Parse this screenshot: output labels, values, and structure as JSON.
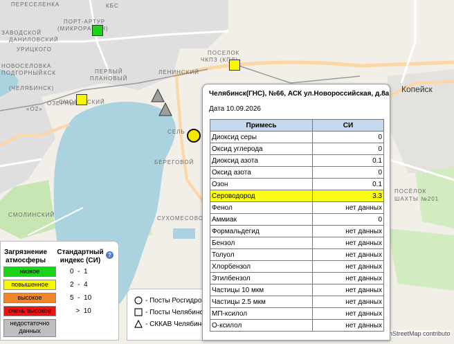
{
  "map": {
    "labels": {
      "pereselenka": "ПЕРЕСЕЛЕНКА",
      "kbs": "КБС",
      "port_artur": "ПОРТ-АРТУР",
      "mikrorayon": "(МИКРОРАЙОН)",
      "zavodskoy": "ЗАВОДСКОЙ",
      "danilovskiy": "ДАНИЛОВСКИЙ",
      "urickogo": "УРИЦКОГО",
      "poselok1": "ПОСЕЛОК",
      "chkpz": "ЧКПЗ (КПД)",
      "leninskiy": "ЛЕНИНСКИЙ",
      "pervyy": "ПЕРВЫЙ",
      "planovyy": "ПЛАНОВЫЙ",
      "novoselovka": "НОВОСЕЛОВКА",
      "podgornyy": "ПОДГОРНЫЙ",
      "ksk": "КСК",
      "chelyabinsk_paren": "(ЧЕЛЯБИНСК)",
      "smolenskiy": "СМОЛЕНСКИЙ",
      "o2": "«О2»",
      "ozernyy": "ОЗЕРНЫЙ",
      "sel": "СЕЛЬ",
      "beregovoy": "БЕРЕГОВОЙ",
      "smolinskiy": "СМОЛИНСКИЙ",
      "suhomesovo": "СУХОМЕСОВО",
      "kopeysk": "Копейск",
      "poselok2": "ПОСЁЛОК",
      "shahty": "ШАХТЫ №201"
    },
    "attribution": "enStreetMap contributo",
    "colors": {
      "water": "#aad3df",
      "land": "#f2efe9",
      "urban": "#e0dfdf",
      "road": "#fcd6a4",
      "green": "#c8e6b4"
    }
  },
  "legend": {
    "pollution_title": "Загрязнение атмосферы",
    "index_title": "Стандартный индекс (СИ)",
    "help_symbol": "?",
    "levels": [
      {
        "label": "низкое",
        "range": "0  -  1",
        "color": "#19d419"
      },
      {
        "label": "повышенное",
        "range": "2  -  4",
        "color": "#f7f700"
      },
      {
        "label": "высокое",
        "range": "5  -  10",
        "color": "#f0852a"
      },
      {
        "label": "очень высокое",
        "range": "   >  10",
        "color": "#ea1414"
      },
      {
        "label": "недостаточно данных",
        "range": "",
        "color": "#bfbfbf"
      }
    ]
  },
  "stations_legend": {
    "items": [
      {
        "icon": "circle",
        "label": "- Посты Росгидромета"
      },
      {
        "icon": "square",
        "label": "- Посты Челябинска"
      },
      {
        "icon": "triangle",
        "label": "- СККАВ Челябинска"
      }
    ]
  },
  "popup": {
    "title": "Челябинск(ГНС), №66, АСК ул.Новороссийская, д.8а",
    "date": "Дата 10.09.2026",
    "columns": [
      "Примесь",
      "СИ"
    ],
    "rows": [
      {
        "name": "Диоксид серы",
        "value": "0"
      },
      {
        "name": "Оксид углерода",
        "value": "0"
      },
      {
        "name": "Диоксид азота",
        "value": "0.1"
      },
      {
        "name": "Оксид азота",
        "value": "0"
      },
      {
        "name": "Озон",
        "value": "0.1"
      },
      {
        "name": "Сероводород",
        "value": "3.3",
        "highlight": true
      },
      {
        "name": "Фенол",
        "value": "нет данных"
      },
      {
        "name": "Аммиак",
        "value": "0"
      },
      {
        "name": "Формальдегид",
        "value": "нет данных"
      },
      {
        "name": "Бензол",
        "value": "нет данных"
      },
      {
        "name": "Толуол",
        "value": "нет данных"
      },
      {
        "name": "Хлорбензол",
        "value": "нет данных"
      },
      {
        "name": "Этилбензол",
        "value": "нет данных"
      },
      {
        "name": "Частицы 10 мкм",
        "value": "нет данных"
      },
      {
        "name": "Частицы 2.5 мкм",
        "value": "нет данных"
      },
      {
        "name": "МП-ксилол",
        "value": "нет данных"
      },
      {
        "name": "О-ксилол",
        "value": "нет данных"
      }
    ]
  },
  "markers": [
    {
      "type": "square",
      "color": "#19d419",
      "name": "marker-port-artur"
    },
    {
      "type": "square",
      "color": "#f7f700",
      "name": "marker-chkpz"
    },
    {
      "type": "square",
      "color": "#f7f700",
      "name": "marker-smolenskiy"
    },
    {
      "type": "triangle",
      "color": "#9e9e9e",
      "name": "marker-skkav-1"
    },
    {
      "type": "triangle",
      "color": "#9e9e9e",
      "name": "marker-skkav-2"
    },
    {
      "type": "circle",
      "color": "#f5e600",
      "name": "marker-gns-66"
    }
  ]
}
